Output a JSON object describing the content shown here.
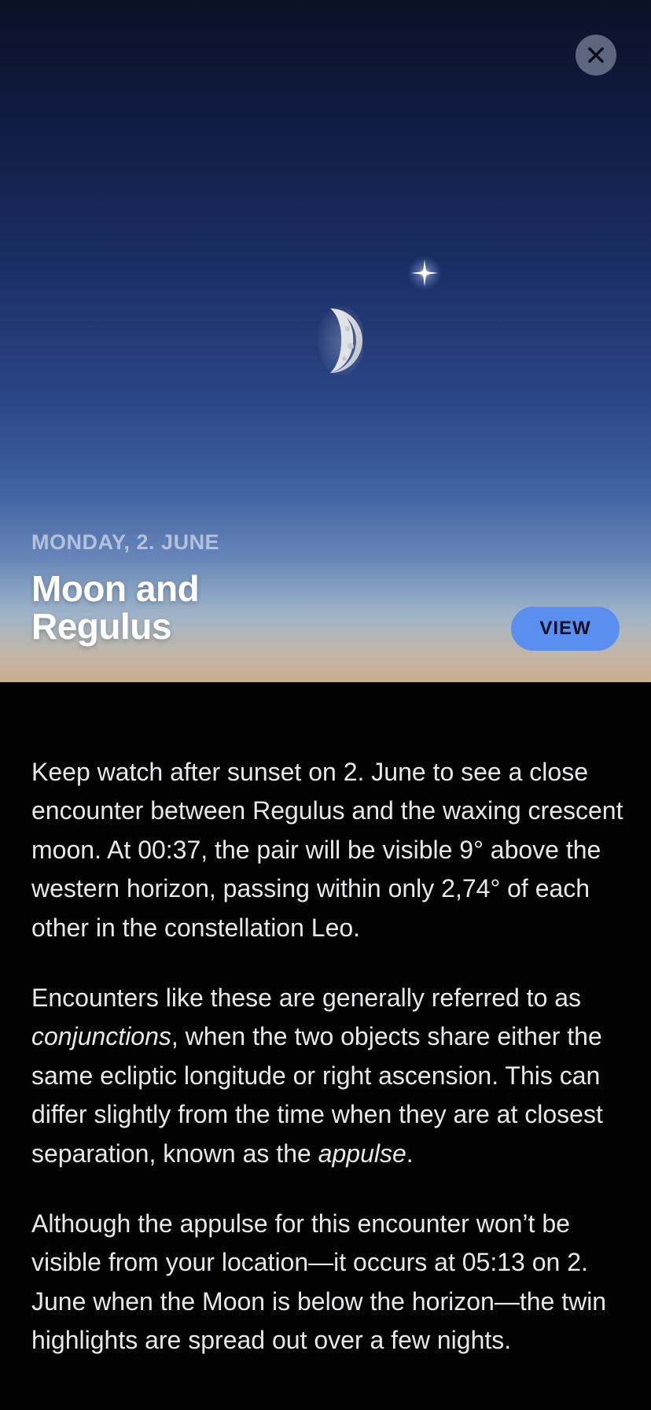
{
  "header": {
    "close_icon": "close-icon"
  },
  "hero": {
    "date": "MONDAY, 2. JUNE",
    "title": "Moon and Regulus",
    "view_label": "VIEW",
    "moon_icon": "crescent-moon",
    "star_icon": "star-regulus"
  },
  "article": {
    "p1": "Keep watch after sunset on 2. June to see a close encounter between Regulus and the waxing crescent moon. At 00:37, the pair will be visible 9° above the western horizon, passing within only 2,74° of each other in the constellation Leo.",
    "p2_before": "Encounters like these are generally referred to as ",
    "p2_term1": "conjunctions",
    "p2_middle": ", when the two objects share either the same ecliptic longitude or right ascension. This can differ slightly from the time when they are at closest separation, known as the ",
    "p2_term2": "appulse",
    "p2_after": ".",
    "p3": "Although the appulse for this encounter won’t be visible from your location—it occurs at 05:13 on 2. June when the Moon is below the horizon—the twin highlights are spread out over a few nights."
  },
  "colors": {
    "accent": "#5a8ff0",
    "background": "#020203",
    "text": "#e8e8ea"
  }
}
